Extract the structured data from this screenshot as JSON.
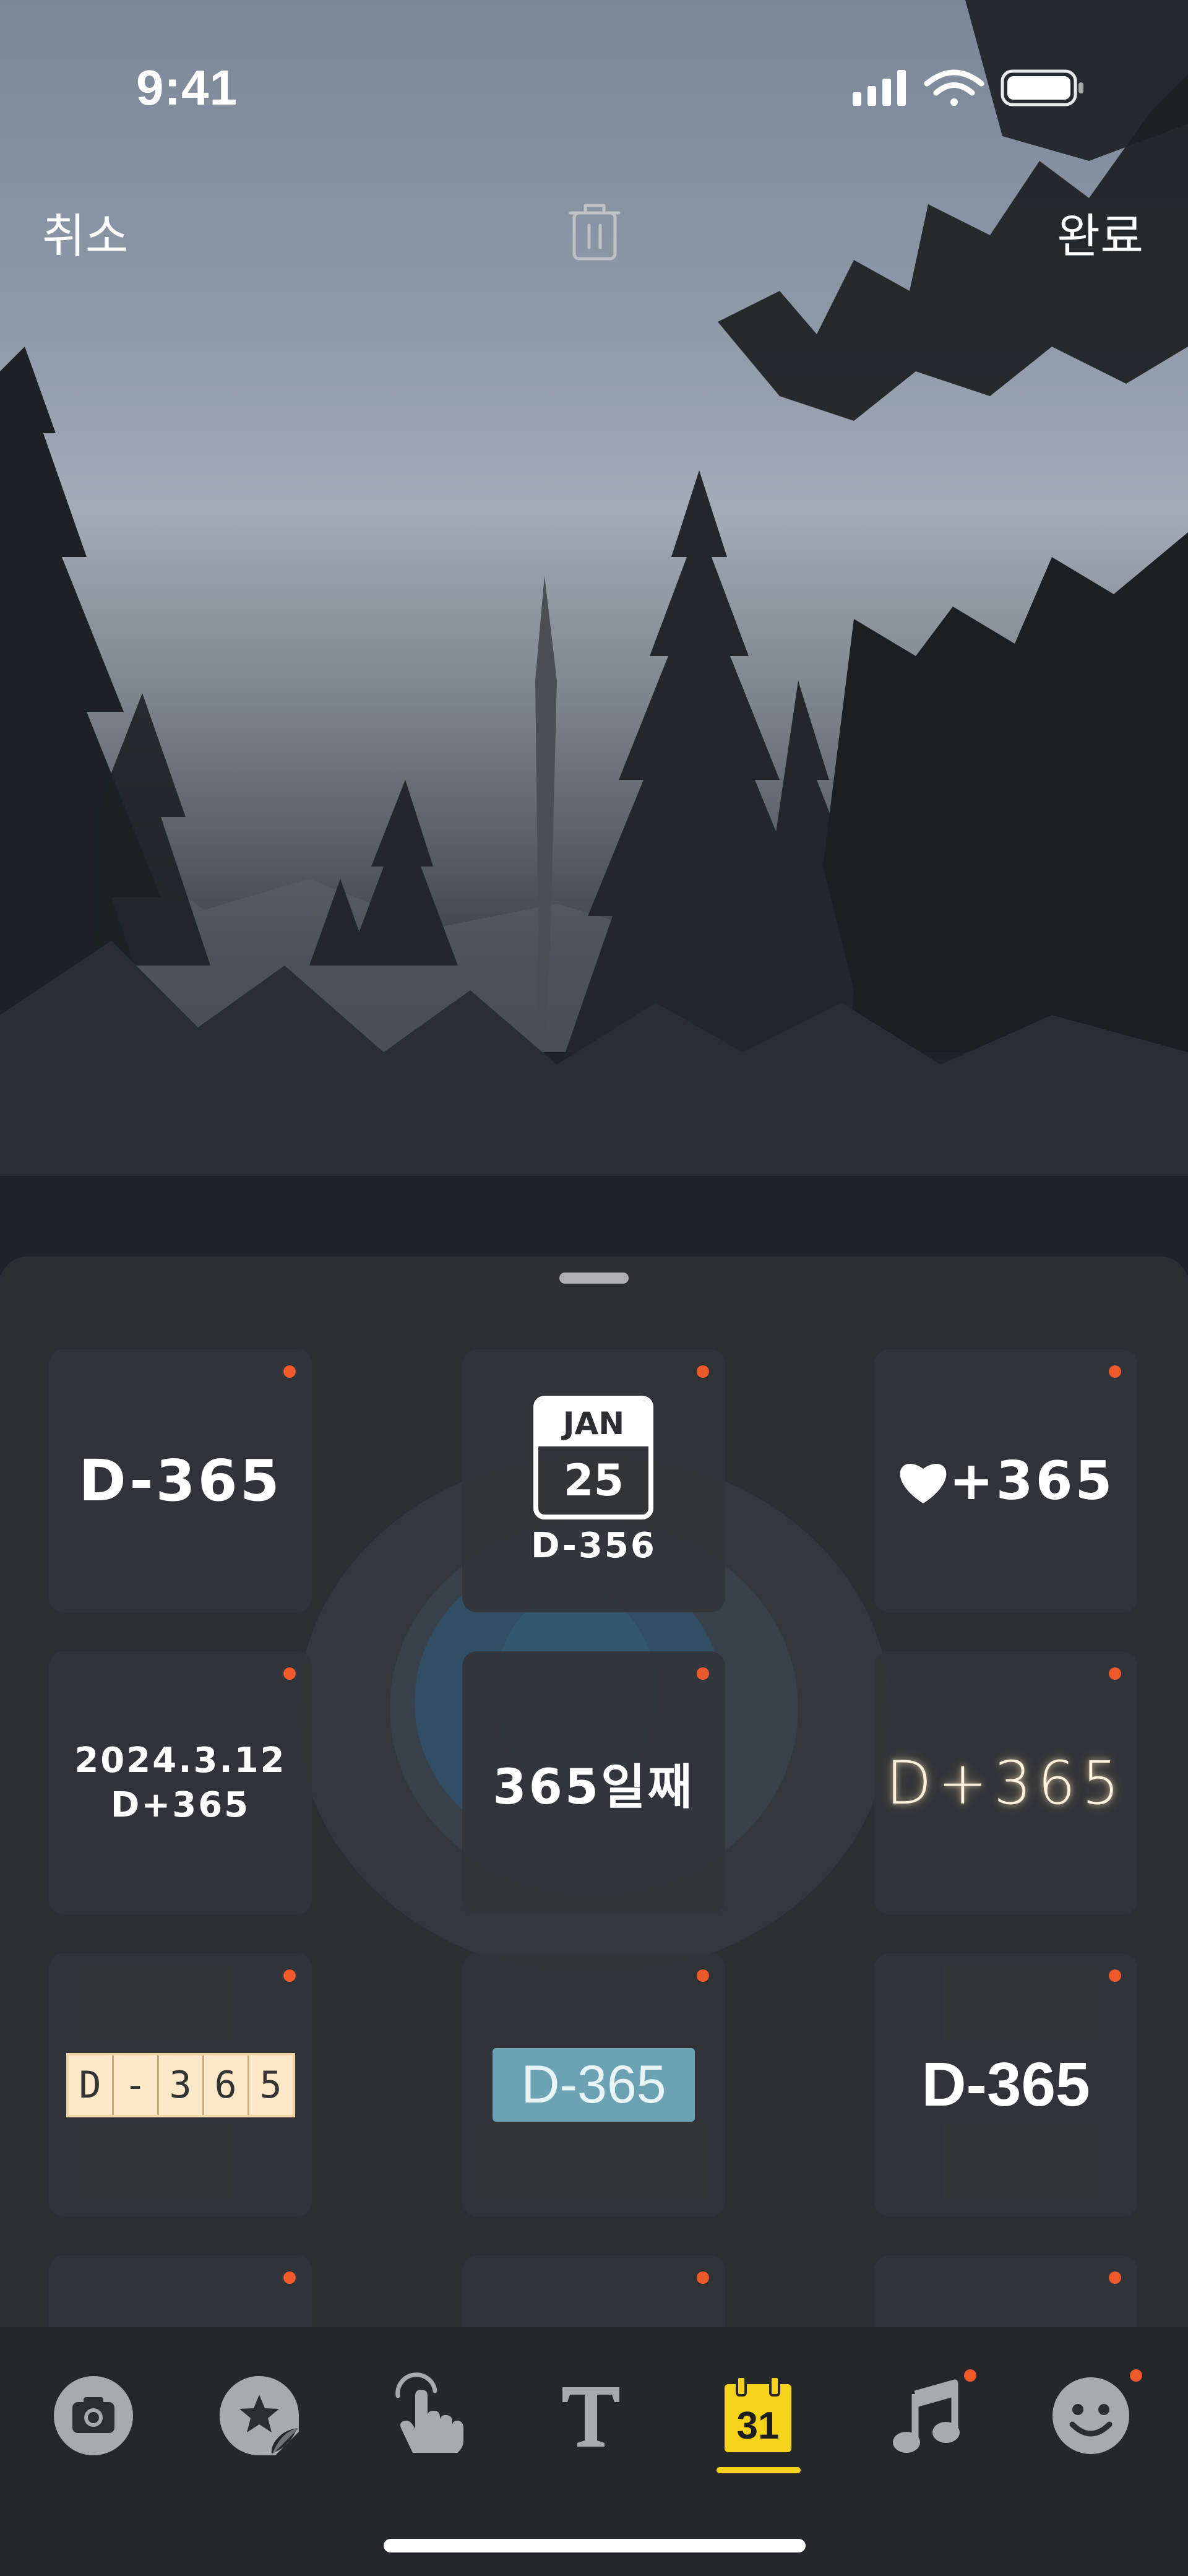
{
  "status_bar": {
    "time": "9:41"
  },
  "top_bar": {
    "cancel_label": "취소",
    "done_label": "완료"
  },
  "stickers": [
    {
      "name": "dday-plain",
      "text": "D-365"
    },
    {
      "name": "dday-calendar",
      "month": "JAN",
      "day": "25",
      "text": "D-356"
    },
    {
      "name": "dday-heart",
      "text": "+365"
    },
    {
      "name": "dday-date",
      "date": "2024.3.12",
      "text": "D+365"
    },
    {
      "name": "dday-korean",
      "text": "365일째"
    },
    {
      "name": "dday-glow",
      "text": "D+365"
    },
    {
      "name": "dday-ruled",
      "chars": [
        "D",
        "-",
        "3",
        "6",
        "5"
      ]
    },
    {
      "name": "dday-badge",
      "text": "D-365"
    },
    {
      "name": "dday-bold",
      "text": "D-365"
    }
  ],
  "tabs": [
    {
      "name": "camera",
      "icon": "camera-icon",
      "badge": false
    },
    {
      "name": "sticker",
      "icon": "star-sticker-icon",
      "badge": false
    },
    {
      "name": "touch",
      "icon": "hand-pointer-icon",
      "badge": false
    },
    {
      "name": "text",
      "icon": "text-icon",
      "badge": false
    },
    {
      "name": "dday",
      "icon": "calendar-icon",
      "label": "31",
      "active": true,
      "badge": false
    },
    {
      "name": "music",
      "icon": "music-note-icon",
      "badge": true
    },
    {
      "name": "emoji",
      "icon": "smiley-icon",
      "badge": true
    }
  ],
  "colors": {
    "accent_yellow": "#f6d21a",
    "badge_orange": "#ee5a2a",
    "sheet_bg": "#2c2e32",
    "tabbar_bg": "#26272a"
  }
}
